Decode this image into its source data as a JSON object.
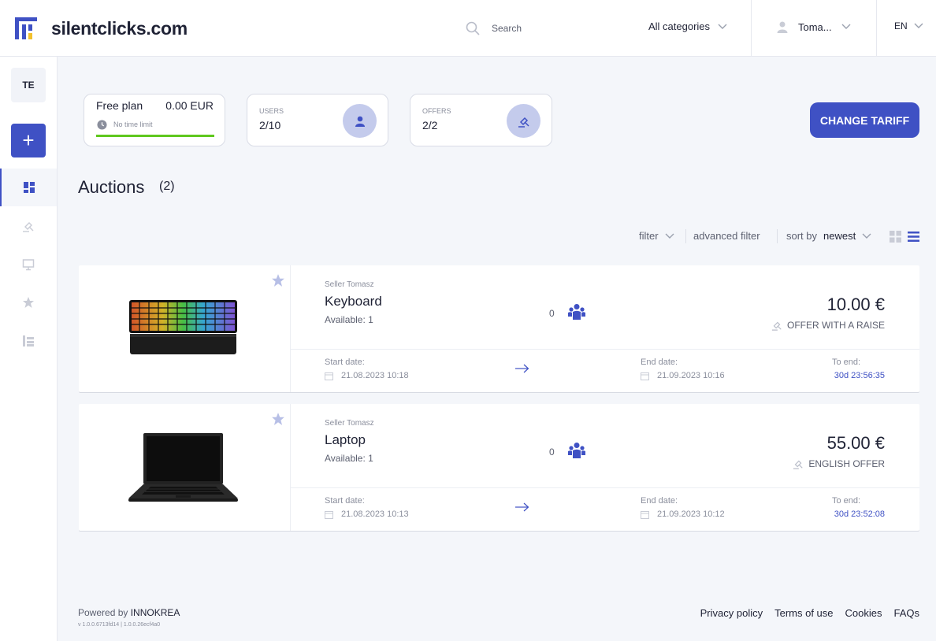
{
  "header": {
    "site_name": "silentclicks.com",
    "search_placeholder": "Search",
    "category_label": "All categories",
    "user_name": "Toma...",
    "language": "EN"
  },
  "sidebar": {
    "avatar_initials": "TE",
    "add_label": "+",
    "items": [
      {
        "name": "dashboard",
        "icon": "dashboard-icon",
        "active": true
      },
      {
        "name": "auctions",
        "icon": "gavel-icon",
        "active": false
      },
      {
        "name": "monitor",
        "icon": "monitor-icon",
        "active": false
      },
      {
        "name": "favourites",
        "icon": "star-icon",
        "active": false
      },
      {
        "name": "tree",
        "icon": "tree-list-icon",
        "active": false
      }
    ]
  },
  "plan": {
    "name": "Free plan",
    "price": "0.00 EUR",
    "limit": "No time limit",
    "usage_fraction": 1.0
  },
  "stats": {
    "users": {
      "label": "USERS",
      "value": "2/10",
      "icon": "user-icon"
    },
    "offers": {
      "label": "OFFERS",
      "value": "2/2",
      "icon": "gavel-icon"
    }
  },
  "change_tariff_label": "CHANGE TARIFF",
  "page": {
    "title": "Auctions",
    "count": "(2)"
  },
  "toolbar": {
    "filter": "filter",
    "advanced_filter": "advanced filter",
    "sort_by": "sort by",
    "sort_value": "newest"
  },
  "auctions": [
    {
      "seller": "Seller Tomasz",
      "title": "Keyboard",
      "available": "Available: 1",
      "bids": "0",
      "price": "10.00 €",
      "offer_type": "OFFER WITH A RAISE",
      "start_label": "Start date:",
      "start_date": "21.08.2023 10:18",
      "end_label": "End date:",
      "end_date": "21.09.2023 10:16",
      "to_end_label": "To end:",
      "to_end": "30d 23:56:35"
    },
    {
      "seller": "Seller Tomasz",
      "title": "Laptop",
      "available": "Available: 1",
      "bids": "0",
      "price": "55.00 €",
      "offer_type": "ENGLISH OFFER",
      "start_label": "Start date:",
      "start_date": "21.08.2023 10:13",
      "end_label": "End date:",
      "end_date": "21.09.2023 10:12",
      "to_end_label": "To end:",
      "to_end": "30d 23:52:08"
    }
  ],
  "footer": {
    "powered_prefix": "Powered by",
    "powered_brand": "INNOKREA",
    "version": "v 1.0.0.6713fd14 | 1.0.0.26ecf4a0",
    "links": [
      "Privacy policy",
      "Terms of use",
      "Cookies",
      "FAQs"
    ]
  },
  "colors": {
    "accent": "#3f51c4",
    "accent_light": "#c4cbec",
    "progress": "#5fc81e",
    "background": "#f4f6fa"
  }
}
